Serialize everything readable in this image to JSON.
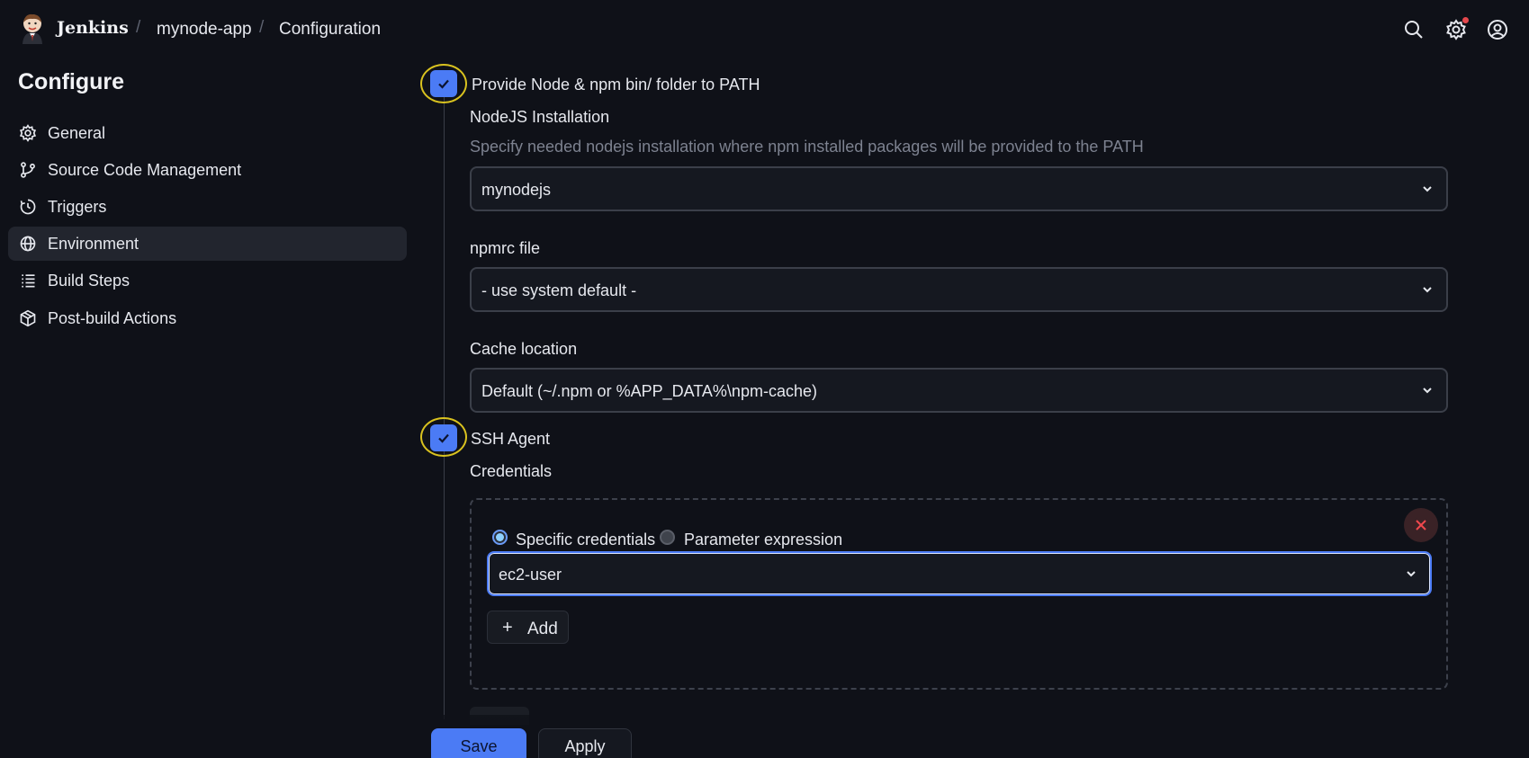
{
  "header": {
    "brand": "Jenkins",
    "breadcrumbs": [
      "mynode-app",
      "Configuration"
    ],
    "separator": "/",
    "icons": [
      "search-icon",
      "settings-icon",
      "user-icon"
    ]
  },
  "sidebar": {
    "title": "Configure",
    "items": [
      {
        "label": "General",
        "icon": "gear-icon"
      },
      {
        "label": "Source Code Management",
        "icon": "branch-icon"
      },
      {
        "label": "Triggers",
        "icon": "clock-icon"
      },
      {
        "label": "Environment",
        "icon": "globe-icon",
        "active": true
      },
      {
        "label": "Build Steps",
        "icon": "list-icon"
      },
      {
        "label": "Post-build Actions",
        "icon": "package-icon"
      }
    ]
  },
  "main": {
    "node_checkbox_label": "Provide Node & npm bin/ folder to PATH",
    "nodejs_installation_label": "NodeJS Installation",
    "nodejs_installation_help": "Specify needed nodejs installation where npm installed packages will be provided to the PATH",
    "nodejs_installation_value": "mynodejs",
    "npmrc_label": "npmrc file",
    "npmrc_value": "- use system default -",
    "cache_label": "Cache location",
    "cache_value": "Default (~/.npm or %APP_DATA%\\npm-cache)",
    "ssh_checkbox_label": "SSH Agent",
    "credentials_label": "Credentials",
    "radio_specific": "Specific credentials",
    "radio_parameter": "Parameter expression",
    "credentials_value": "ec2-user",
    "add_label": "Add"
  },
  "footer": {
    "save_label": "Save",
    "apply_label": "Apply"
  },
  "colors": {
    "accent": "#4b7bf5",
    "background": "#0f1118",
    "highlight_ring": "#d9c21f",
    "notification": "#e5484d"
  }
}
